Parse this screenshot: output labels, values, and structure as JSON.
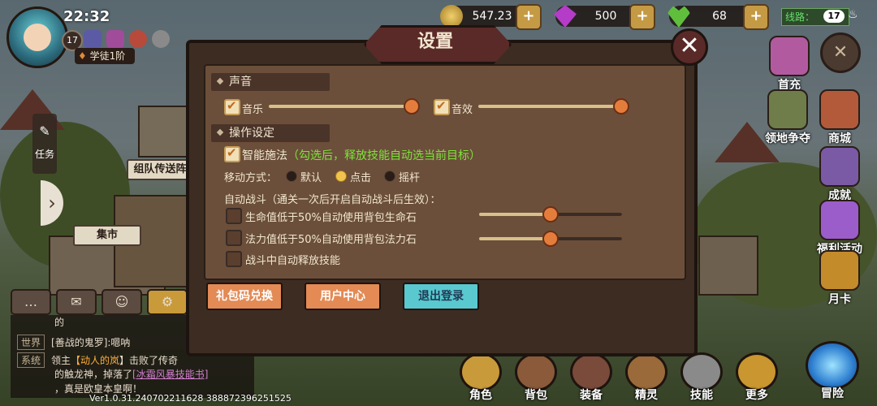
{
  "hud": {
    "time": "22:32",
    "level": "17",
    "rank": "学徒1阶",
    "gold": "547.23万",
    "gems": "500",
    "stamina": "68",
    "line_label": "线路：",
    "line_num": "17",
    "plus": "+"
  },
  "side_menu": [
    {
      "label": "首充",
      "icon": "gift-box-icon",
      "color": "#b25aa0"
    },
    {
      "label": "领地争夺",
      "icon": "territory-shield-icon",
      "color": "#6e7d4a"
    },
    {
      "label": "商城",
      "icon": "shop-tent-icon",
      "color": "#b35a3a"
    },
    {
      "label": "成就",
      "icon": "trophy-icon",
      "color": "#7a5aa5"
    },
    {
      "label": "福利活动",
      "icon": "present-icon",
      "color": "#9b5dc9"
    },
    {
      "label": "月卡",
      "icon": "card-icon",
      "color": "#c38b2a"
    }
  ],
  "map_signs": {
    "party": "组队传送阵",
    "market": "集市"
  },
  "task_tab": "任务",
  "chat": {
    "line1_prefix": "的",
    "world_tag": "世界",
    "world_user": "[善战的鬼罗",
    "world_suffix": "]:嗯呐",
    "system_tag": "系统",
    "system_a": "领主",
    "system_name": "【动人的岚",
    "system_b": "】击败了传奇",
    "system_c": "的触龙神，掉落了",
    "system_item": "[冰霜风暴技能书]",
    "system_d": "，真是欧皇本皇啊！"
  },
  "version": "Ver1.0.31.240702211628 388872396251525",
  "dock": [
    {
      "label": "角色",
      "icon": "character-icon"
    },
    {
      "label": "背包",
      "icon": "bag-icon"
    },
    {
      "label": "装备",
      "icon": "armor-icon"
    },
    {
      "label": "精灵",
      "icon": "spirit-icon"
    },
    {
      "label": "技能",
      "icon": "sword-icon"
    },
    {
      "label": "更多",
      "icon": "more-icon"
    },
    {
      "label": "冒险",
      "icon": "adventure-portal-icon"
    }
  ],
  "settings": {
    "title": "设置",
    "sound_section": "声音",
    "music_label": "音乐",
    "music_level": 1.0,
    "sfx_label": "音效",
    "sfx_level": 1.0,
    "control_section": "操作设定",
    "smart_cast": "智能施法",
    "smart_cast_hint": "（勾选后，释放技能自动选当前目标）",
    "move_label": "移动方式：",
    "move_options": [
      "默认",
      "点击",
      "摇杆"
    ],
    "move_selected": "点击",
    "auto_battle": "自动战斗（通关一次后开启自动战斗后生效）：",
    "hp_option": "生命值低于50%自动使用背包生命石",
    "hp_threshold": 0.5,
    "mp_option": "法力值低于50%自动使用背包法力石",
    "mp_threshold": 0.5,
    "auto_skill": "战斗中自动释放技能",
    "gift_code_btn": "礼包码兑换",
    "user_center_btn": "用户中心",
    "logout_btn": "退出登录"
  }
}
